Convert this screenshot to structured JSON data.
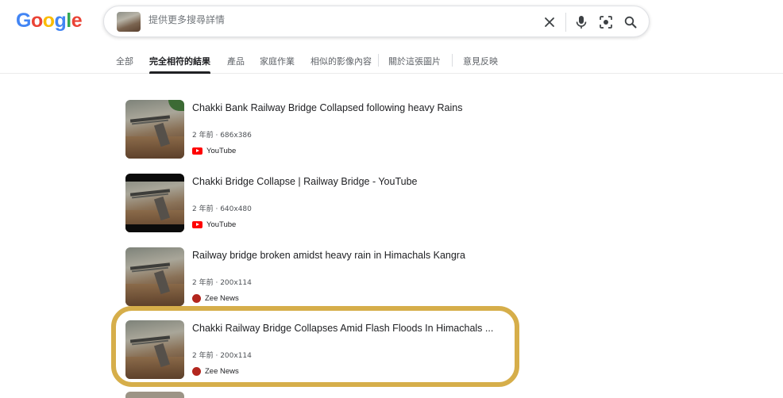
{
  "logo": {
    "letters": [
      "G",
      "o",
      "o",
      "g",
      "l",
      "e"
    ],
    "colors": [
      "#4285F4",
      "#EA4335",
      "#FBBC05",
      "#4285F4",
      "#34A853",
      "#EA4335"
    ]
  },
  "search": {
    "placeholder": "提供更多搜尋詳情",
    "value": ""
  },
  "icons": {
    "clear": "close-icon",
    "voice": "microphone-icon",
    "lens": "lens-icon",
    "search": "search-icon"
  },
  "tabs": [
    {
      "label": "全部",
      "active": false
    },
    {
      "label": "完全相符的結果",
      "active": true
    },
    {
      "label": "產品",
      "active": false
    },
    {
      "label": "家庭作業",
      "active": false
    },
    {
      "label": "相似的影像內容",
      "active": false
    },
    {
      "label": "關於這張圖片",
      "active": false
    },
    {
      "label": "意見反映",
      "active": false
    }
  ],
  "results": [
    {
      "title": "Chakki Bank Railway Bridge Collapsed following heavy Rains",
      "age": "2 年前",
      "size": "686x386",
      "source": "YouTube",
      "source_icon": "youtube-icon"
    },
    {
      "title": "Chakki Bridge Collapse | Railway Bridge - YouTube",
      "age": "2 年前",
      "size": "640x480",
      "source": "YouTube",
      "source_icon": "youtube-icon"
    },
    {
      "title": "Railway bridge broken amidst heavy rain in Himachals Kangra",
      "age": "2 年前",
      "size": "200x114",
      "source": "Zee News",
      "source_icon": "zee-news-icon"
    },
    {
      "title": "Chakki Railway Bridge Collapses Amid Flash Floods In Himachals ...",
      "age": "2 年前",
      "size": "200x114",
      "source": "Zee News",
      "source_icon": "zee-news-icon"
    }
  ],
  "meta_separator": " · ",
  "colors": {
    "highlight": "#d6ae4a",
    "youtube": "#ff0000",
    "zee": "#b3261e"
  }
}
